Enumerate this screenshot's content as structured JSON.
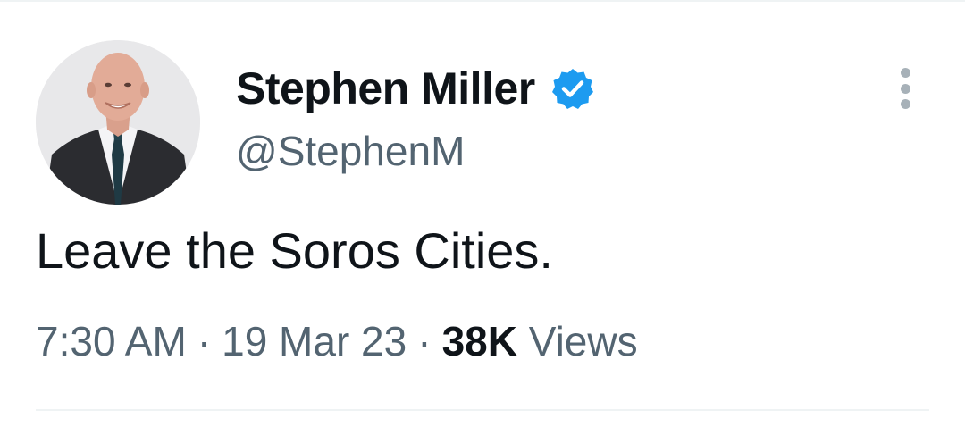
{
  "author": {
    "display_name": "Stephen Miller",
    "handle": "@StephenM",
    "verified_icon": "verified-badge-icon",
    "avatar_alt": "profile photo"
  },
  "tweet": {
    "text": "Leave the Soros Cities."
  },
  "meta": {
    "time": "7:30 AM",
    "date": "19 Mar 23",
    "separator": "·",
    "views_count": "38K",
    "views_label": "Views"
  },
  "actions": {
    "more_icon": "more-options-icon"
  },
  "colors": {
    "text_primary": "#0f1419",
    "text_secondary": "#536471",
    "verified_blue": "#1d9bf0",
    "divider": "#eff3f4"
  }
}
